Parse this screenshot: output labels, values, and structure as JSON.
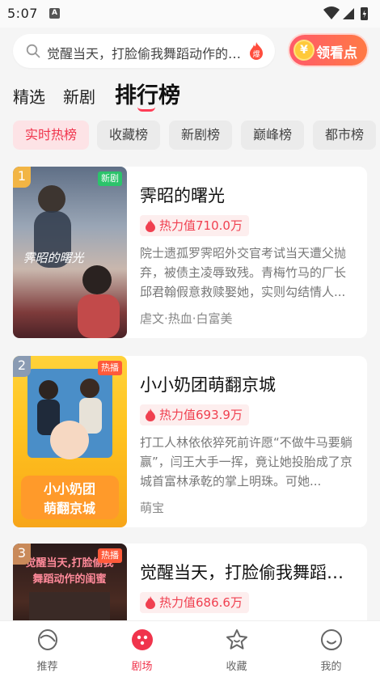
{
  "status_bar": {
    "time": "5:07",
    "notif_letter": "A"
  },
  "search": {
    "text": "觉醒当天，打脸偷我舞蹈动作的闺蜜",
    "hot_badge": "爆"
  },
  "coin_button": {
    "label": "领看点",
    "icon": "coin-icon"
  },
  "tabs": [
    {
      "label": "精选",
      "active": false
    },
    {
      "label": "新剧",
      "active": false
    },
    {
      "label": "排行榜",
      "active": true
    }
  ],
  "chips": [
    {
      "label": "实时热榜",
      "active": true
    },
    {
      "label": "收藏榜",
      "active": false
    },
    {
      "label": "新剧榜",
      "active": false
    },
    {
      "label": "巅峰榜",
      "active": false
    },
    {
      "label": "都市榜",
      "active": false
    }
  ],
  "cards": [
    {
      "rank": "1",
      "badge": "新剧",
      "title": "霁昭的曙光",
      "heat": "热力值710.0万",
      "desc": "院士遗孤罗霁昭外交官考试当天遭父抛弃，被债主凌辱致残。青梅竹马的厂长邱君翰假意救赎娶她，实则勾结情人...",
      "tags": "虐文·热血·白富美",
      "poster_text": "霁昭的曙光"
    },
    {
      "rank": "2",
      "badge": "热播",
      "title": "小小奶团萌翻京城",
      "heat": "热力值693.9万",
      "desc": "打工人林依依猝死前许愿“不做牛马要躺赢”，闫王大手一挥，竟让她投胎成了京城首富林承乾的掌上明珠。可她...",
      "tags": "萌宝",
      "poster_text": "小小奶团 萌翻京城"
    },
    {
      "rank": "3",
      "badge": "热播",
      "title": "觉醒当天，打脸偷我舞蹈动作的闺蜜",
      "heat": "热力值686.6万",
      "desc": "",
      "tags": "",
      "poster_text": "觉醒当天,打脸偷我 舞蹈动作的闺蜜"
    }
  ],
  "bottom_nav": [
    {
      "label": "推荐",
      "icon": "recommend-icon",
      "active": false
    },
    {
      "label": "剧场",
      "icon": "theater-icon",
      "active": true
    },
    {
      "label": "收藏",
      "icon": "star-icon",
      "active": false
    },
    {
      "label": "我的",
      "icon": "smile-icon",
      "active": false
    }
  ],
  "colors": {
    "accent": "#f0344c",
    "heat_bg": "#fdeeee",
    "chip_active_bg": "#fde3e6"
  }
}
